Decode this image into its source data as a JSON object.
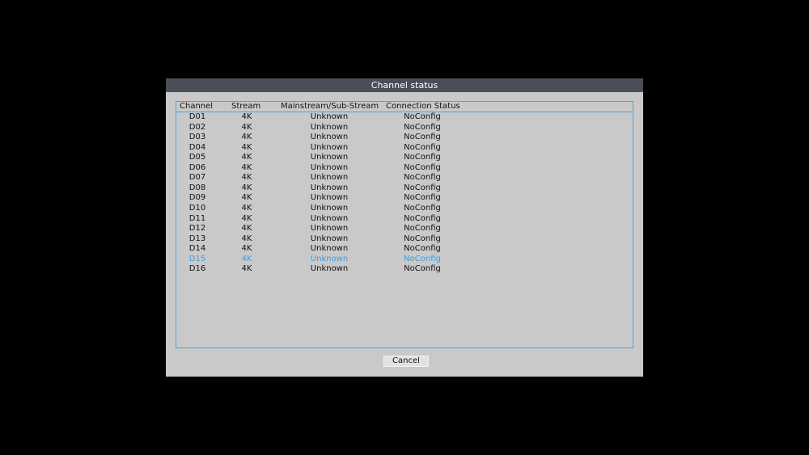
{
  "dialog": {
    "title": "Channel status",
    "cancel_label": "Cancel"
  },
  "table": {
    "columns": [
      "Channel",
      "Stream",
      "Mainstream/Sub-Stream",
      "Connection Status"
    ],
    "rows": [
      {
        "channel": "D01",
        "stream": "4K",
        "mainstream": "Unknown",
        "status": "NoConfig"
      },
      {
        "channel": "D02",
        "stream": "4K",
        "mainstream": "Unknown",
        "status": "NoConfig"
      },
      {
        "channel": "D03",
        "stream": "4K",
        "mainstream": "Unknown",
        "status": "NoConfig"
      },
      {
        "channel": "D04",
        "stream": "4K",
        "mainstream": "Unknown",
        "status": "NoConfig"
      },
      {
        "channel": "D05",
        "stream": "4K",
        "mainstream": "Unknown",
        "status": "NoConfig"
      },
      {
        "channel": "D06",
        "stream": "4K",
        "mainstream": "Unknown",
        "status": "NoConfig"
      },
      {
        "channel": "D07",
        "stream": "4K",
        "mainstream": "Unknown",
        "status": "NoConfig"
      },
      {
        "channel": "D08",
        "stream": "4K",
        "mainstream": "Unknown",
        "status": "NoConfig"
      },
      {
        "channel": "D09",
        "stream": "4K",
        "mainstream": "Unknown",
        "status": "NoConfig"
      },
      {
        "channel": "D10",
        "stream": "4K",
        "mainstream": "Unknown",
        "status": "NoConfig"
      },
      {
        "channel": "D11",
        "stream": "4K",
        "mainstream": "Unknown",
        "status": "NoConfig"
      },
      {
        "channel": "D12",
        "stream": "4K",
        "mainstream": "Unknown",
        "status": "NoConfig"
      },
      {
        "channel": "D13",
        "stream": "4K",
        "mainstream": "Unknown",
        "status": "NoConfig"
      },
      {
        "channel": "D14",
        "stream": "4K",
        "mainstream": "Unknown",
        "status": "NoConfig"
      },
      {
        "channel": "D15",
        "stream": "4K",
        "mainstream": "Unknown",
        "status": "NoConfig"
      },
      {
        "channel": "D16",
        "stream": "4K",
        "mainstream": "Unknown",
        "status": "NoConfig"
      }
    ],
    "selected_channel": "D15"
  },
  "colors": {
    "background": "#000000",
    "dialog_bg": "#c9c9c9",
    "titlebar_bg": "#4a4f57",
    "accent": "#3f9de0"
  }
}
